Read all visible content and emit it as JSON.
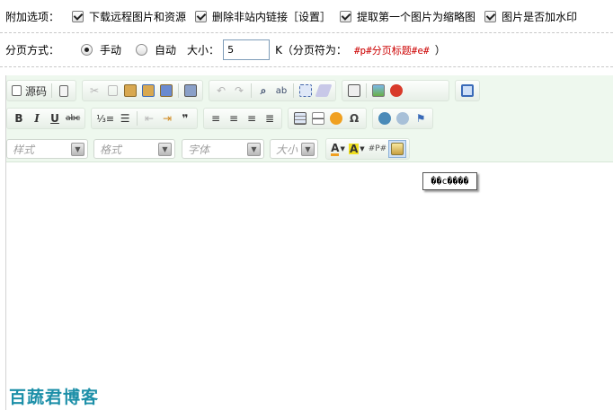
{
  "options": {
    "label": "附加选项：",
    "items": [
      {
        "label": "下载远程图片和资源",
        "checked": true
      },
      {
        "label": "删除非站内链接［设置］",
        "checked": true
      },
      {
        "label": "提取第一个图片为缩略图",
        "checked": true
      },
      {
        "label": "图片是否加水印",
        "checked": true
      }
    ]
  },
  "paging": {
    "label": "分页方式：",
    "manual_label": "手动",
    "auto_label": "自动",
    "selected": "manual",
    "size_label": "大小：",
    "size_value": "5",
    "unit_text": "K（分页符为：",
    "separator_code": "#p#分页标题#e#",
    "close_paren": "）"
  },
  "toolbar": {
    "source_label": "源码",
    "dropdowns": {
      "style": "样式",
      "format": "格式",
      "font": "字体",
      "size": "大小"
    },
    "icons": [
      "source-icon",
      "document-icon",
      "cut-icon",
      "copy-icon",
      "paste-icon",
      "paste-text-icon",
      "paste-word-icon",
      "print-icon",
      "undo-icon",
      "redo-icon",
      "find-icon",
      "replace-icon",
      "select-all-icon",
      "remove-format-icon",
      "preview-icon",
      "image-icon",
      "flash-icon",
      "maximize-icon",
      "bold-icon",
      "italic-icon",
      "underline-icon",
      "strike-icon",
      "numbered-list-icon",
      "bulleted-list-icon",
      "outdent-icon",
      "indent-icon",
      "blockquote-icon",
      "align-left-icon",
      "align-center-icon",
      "align-right-icon",
      "align-justify-icon",
      "table-icon",
      "horizontal-rule-icon",
      "smiley-icon",
      "special-char-icon",
      "link-icon",
      "unlink-icon",
      "anchor-icon",
      "text-color-icon",
      "bg-color-icon",
      "page-break-icon",
      "dede-icon"
    ]
  },
  "tooltip": "��c����",
  "watermark": "百蔬君博客",
  "colors": {
    "toolbar_bg": "#eef8ee",
    "separator_red": "#cc0000",
    "watermark": "#1c8fa8"
  }
}
